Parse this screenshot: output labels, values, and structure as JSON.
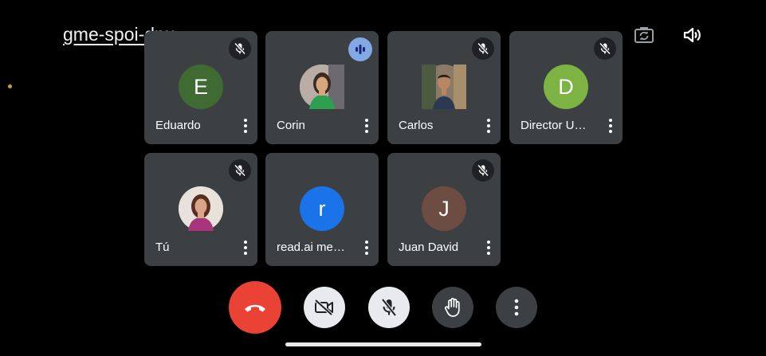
{
  "meeting": {
    "code": "gme-spoi-dpu"
  },
  "top_icons": [
    "camera-flip-icon",
    "speaker-icon"
  ],
  "participants": [
    {
      "name": "Eduardo",
      "initial": "E",
      "avatar_color": "#3f6b32",
      "photo": false,
      "status": "muted"
    },
    {
      "name": "Corin",
      "initial": "",
      "avatar_color": "#c9c1bb",
      "photo": true,
      "status": "speaking"
    },
    {
      "name": "Carlos",
      "initial": "",
      "avatar_color": "#6b5b4b",
      "photo": true,
      "status": "muted"
    },
    {
      "name": "Director U…",
      "initial": "D",
      "avatar_color": "#7cb342",
      "photo": false,
      "status": "muted"
    },
    {
      "name": "Tú",
      "initial": "",
      "avatar_color": "#e6ddd6",
      "photo": true,
      "status": "muted"
    },
    {
      "name": "read.ai me…",
      "initial": "r",
      "avatar_color": "#1a73e8",
      "photo": false,
      "status": "none"
    },
    {
      "name": "Juan David",
      "initial": "J",
      "avatar_color": "#6d4c41",
      "photo": false,
      "status": "muted"
    }
  ],
  "controls": [
    "end-call-button",
    "camera-off-button",
    "mic-off-button",
    "raise-hand-button",
    "more-options-button"
  ],
  "colors": {
    "tile_bg": "#3c4043",
    "end_call": "#ea4335",
    "light_button": "#e8eaed",
    "speaking": "#8ab4f8"
  }
}
